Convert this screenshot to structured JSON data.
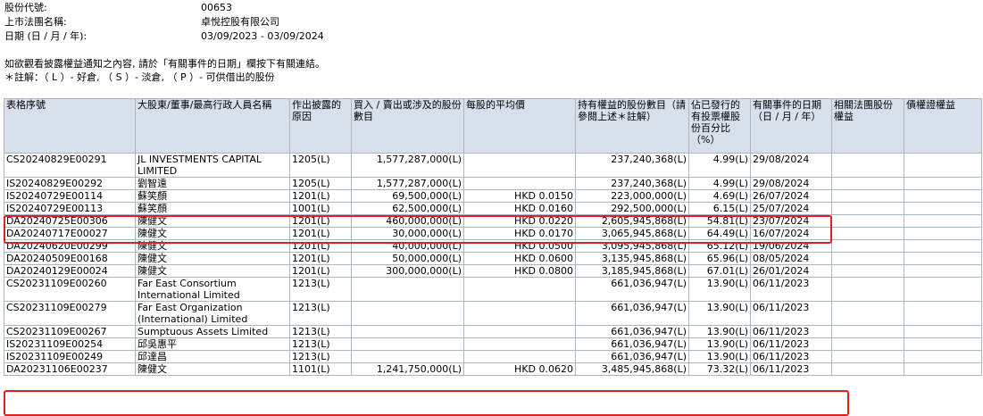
{
  "header": {
    "stock_code_label": "股份代號:",
    "stock_code": "00653",
    "company_label": "上市法團名稱:",
    "company": "卓悅控股有限公司",
    "date_label": "日期 (日 / 月 / 年):",
    "date_range": "03/09/2023 - 03/09/2024"
  },
  "notes": {
    "line1": "如欲觀看披露權益通知之內容, 請於「有關事件的日期」欄按下有關連結。",
    "line2": "＊註解：（ L ）- 好倉, （ S ）- 淡倉, （ P ）- 可供借出的股份"
  },
  "columns": [
    "表格序號",
    "大股東/董事/最高行政人員名稱",
    "作出披露的原因",
    "買入 / 賣出或涉及的股份數目",
    "每股的平均價",
    "持有權益的股份數目（請參閱上述＊註解）",
    "佔已發行的有投票權股份百分比（%）",
    "有關事件的日期（日 / 月 / 年）",
    "相關法團股份權益",
    "債權證權益"
  ],
  "rows": [
    {
      "form": "CS20240829E00291",
      "name": "JL INVESTMENTS CAPITAL LIMITED",
      "reason": "1205(L)",
      "shares": "1,577,287,000(L)",
      "price": "",
      "held": "237,240,368(L)",
      "pct": "4.99(L)",
      "date": "29/08/2024",
      "tall": true
    },
    {
      "form": "IS20240829E00292",
      "name": "劉智遠",
      "reason": "1205(L)",
      "shares": "1,577,287,000(L)",
      "price": "",
      "held": "237,240,368(L)",
      "pct": "4.99(L)",
      "date": "29/08/2024"
    },
    {
      "form": "IS20240729E00114",
      "name": "蘇笑顏",
      "reason": "1201(L)",
      "shares": "69,500,000(L)",
      "price": "HKD 0.0150",
      "held": "223,000,000(L)",
      "pct": "4.69(L)",
      "date": "26/07/2024"
    },
    {
      "form": "IS20240729E00113",
      "name": "蘇笑顏",
      "reason": "1001(L)",
      "shares": "62,500,000(L)",
      "price": "HKD 0.0160",
      "held": "292,500,000(L)",
      "pct": "6.15(L)",
      "date": "25/07/2024"
    },
    {
      "form": "DA20240725E00306",
      "name": "陳健文",
      "reason": "1201(L)",
      "shares": "460,000,000(L)",
      "price": "HKD 0.0220",
      "held": "2,605,945,868(L)",
      "pct": "54.81(L)",
      "date": "23/07/2024"
    },
    {
      "form": "DA20240717E00027",
      "name": "陳健文",
      "reason": "1201(L)",
      "shares": "30,000,000(L)",
      "price": "HKD 0.0170",
      "held": "3,065,945,868(L)",
      "pct": "64.49(L)",
      "date": "16/07/2024"
    },
    {
      "form": "DA20240620E00299",
      "name": "陳健文",
      "reason": "1201(L)",
      "shares": "40,000,000(L)",
      "price": "HKD 0.0500",
      "held": "3,095,945,868(L)",
      "pct": "65.12(L)",
      "date": "19/06/2024"
    },
    {
      "form": "DA20240509E00168",
      "name": "陳健文",
      "reason": "1201(L)",
      "shares": "50,000,000(L)",
      "price": "HKD 0.0600",
      "held": "3,135,945,868(L)",
      "pct": "65.96(L)",
      "date": "08/05/2024"
    },
    {
      "form": "DA20240129E00024",
      "name": "陳健文",
      "reason": "1201(L)",
      "shares": "300,000,000(L)",
      "price": "HKD 0.0800",
      "held": "3,185,945,868(L)",
      "pct": "67.01(L)",
      "date": "26/01/2024"
    },
    {
      "form": "CS20231109E00260",
      "name": "Far East Consortium International Limited",
      "reason": "1213(L)",
      "shares": "",
      "price": "",
      "held": "661,036,947(L)",
      "pct": "13.90(L)",
      "date": "06/11/2023",
      "tall": true
    },
    {
      "form": "CS20231109E00279",
      "name": "Far East Organization (International) Limited",
      "reason": "1213(L)",
      "shares": "",
      "price": "",
      "held": "661,036,947(L)",
      "pct": "13.90(L)",
      "date": "06/11/2023",
      "tall": true
    },
    {
      "form": "CS20231109E00267",
      "name": "Sumptuous Assets Limited",
      "reason": "1213(L)",
      "shares": "",
      "price": "",
      "held": "661,036,947(L)",
      "pct": "13.90(L)",
      "date": "06/11/2023"
    },
    {
      "form": "IS20231109E00254",
      "name": "邱吳惠平",
      "reason": "1213(L)",
      "shares": "",
      "price": "",
      "held": "661,036,947(L)",
      "pct": "13.90(L)",
      "date": "06/11/2023"
    },
    {
      "form": "IS20231109E00249",
      "name": "邱達昌",
      "reason": "1213(L)",
      "shares": "",
      "price": "",
      "held": "661,036,947(L)",
      "pct": "13.90(L)",
      "date": "06/11/2023"
    },
    {
      "form": "DA20231106E00237",
      "name": "陳健文",
      "reason": "1101(L)",
      "shares": "1,241,750,000(L)",
      "price": "HKD 0.0620",
      "held": "3,485,945,868(L)",
      "pct": "73.32(L)",
      "date": "06/11/2023"
    }
  ],
  "colors": {
    "header_bg": "#d8e0ec",
    "border": "#a9b6c8",
    "highlight": "#e02020"
  }
}
